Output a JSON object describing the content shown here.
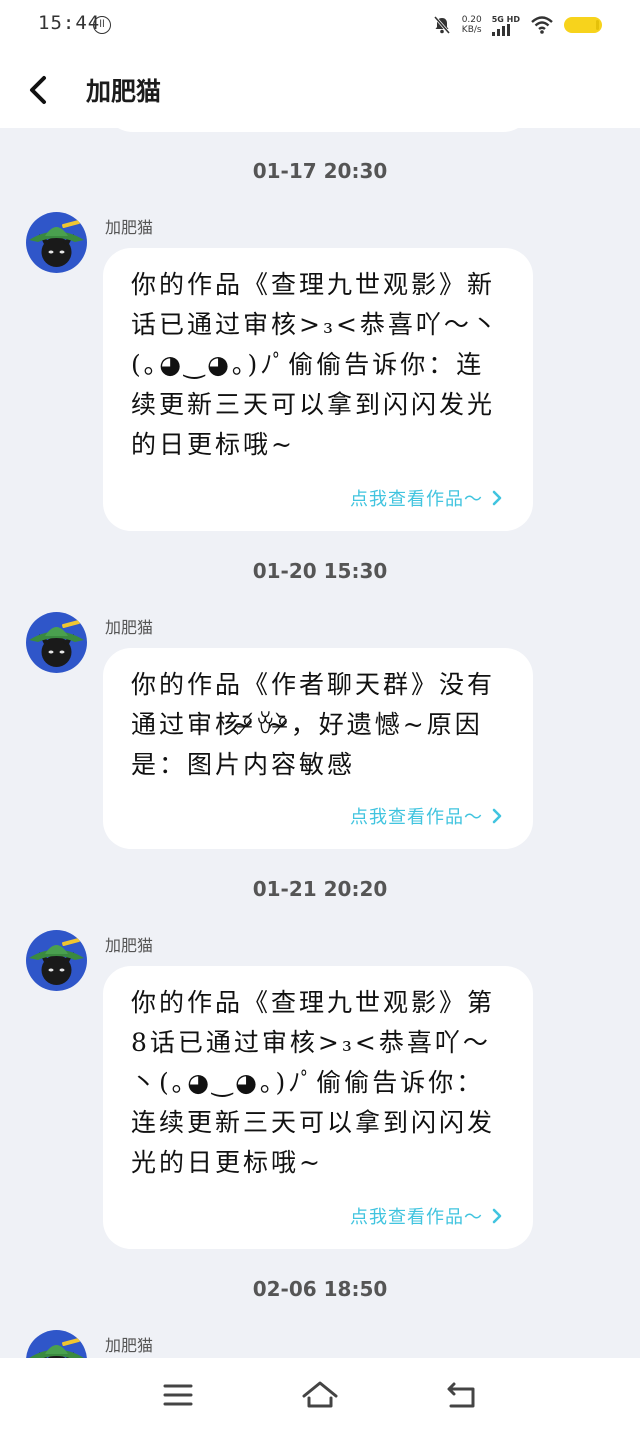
{
  "status_bar": {
    "time": "15:44",
    "badge": "ll",
    "speed_value": "0.20",
    "speed_unit": "KB/s",
    "network": "5G HD",
    "icons": [
      "mute-bell-icon",
      "signal-icon",
      "wifi-icon",
      "battery-icon"
    ]
  },
  "header": {
    "back_icon": "chevron-left-icon",
    "title": "加肥猫"
  },
  "messages": [
    {
      "time": "01-17 20:30",
      "sender": "加肥猫",
      "text": "你的作品《查理九世观影》新话已通过审核>₃<恭喜吖〜丶(｡◕‿◕｡)ﾉﾟ偷偷告诉你：连续更新三天可以拿到闪闪发光的日更标哦~",
      "link": "点我查看作品〜"
    },
    {
      "time": "01-20 15:30",
      "sender": "加肥猫",
      "text": "你的作品《作者聊天群》没有通过审核ᵒ̴̶̷᷄ꈊᵒ̴̶̷᷅，好遗憾~原因是：图片内容敏感",
      "link": "点我查看作品〜"
    },
    {
      "time": "01-21 20:20",
      "sender": "加肥猫",
      "text": "你的作品《查理九世观影》第8话已通过审核>₃<恭喜吖〜丶(｡◕‿◕｡)ﾉﾟ偷偷告诉你：连续更新三天可以拿到闪闪发光的日更标哦~",
      "link": "点我查看作品〜"
    },
    {
      "time": "02-06 18:50",
      "sender": "加肥猫"
    }
  ],
  "nav_bar": {
    "icons": [
      "menu-icon",
      "home-icon",
      "back-icon"
    ]
  }
}
